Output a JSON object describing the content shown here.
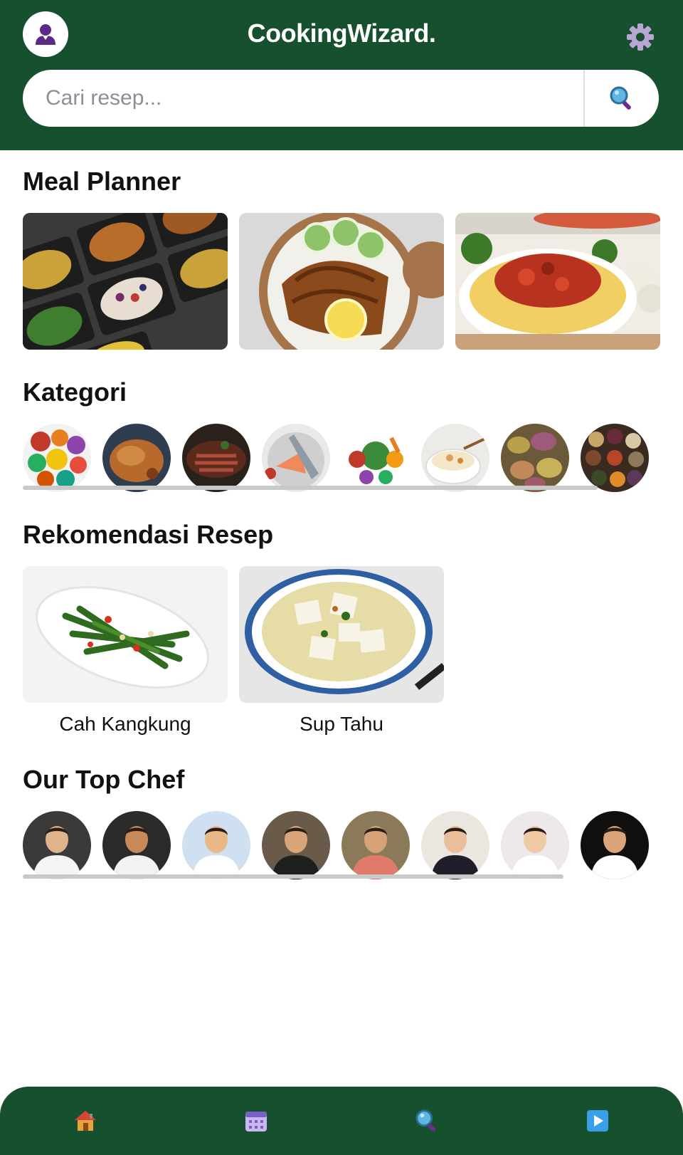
{
  "header": {
    "title": "CookingWizard.",
    "avatar_icon": "user-icon",
    "settings_icon": "gear-icon",
    "search_placeholder": "Cari resep...",
    "search_icon": "magnifier-icon"
  },
  "meal_planner": {
    "title": "Meal Planner",
    "items": [
      {
        "name": "meal-prep-boxes"
      },
      {
        "name": "chicken-rice-bowl"
      },
      {
        "name": "spaghetti-bolognese"
      }
    ]
  },
  "kategori": {
    "title": "Kategori",
    "items": [
      {
        "name": "fruits"
      },
      {
        "name": "chicken"
      },
      {
        "name": "meat"
      },
      {
        "name": "fish"
      },
      {
        "name": "vegetables"
      },
      {
        "name": "rice"
      },
      {
        "name": "potatoes"
      },
      {
        "name": "spices"
      }
    ]
  },
  "rekomendasi": {
    "title": "Rekomendasi Resep",
    "items": [
      {
        "label": "Cah Kangkung"
      },
      {
        "label": "Sup Tahu"
      }
    ]
  },
  "top_chef": {
    "title": "Our Top Chef",
    "count": 9
  },
  "bottom_nav": {
    "items": [
      {
        "icon": "home-icon"
      },
      {
        "icon": "calendar-icon"
      },
      {
        "icon": "search-icon"
      },
      {
        "icon": "play-icon"
      }
    ]
  },
  "colors": {
    "brand": "#16502e",
    "background": "#ffffff",
    "scroll_track": "#c9c9c9"
  }
}
